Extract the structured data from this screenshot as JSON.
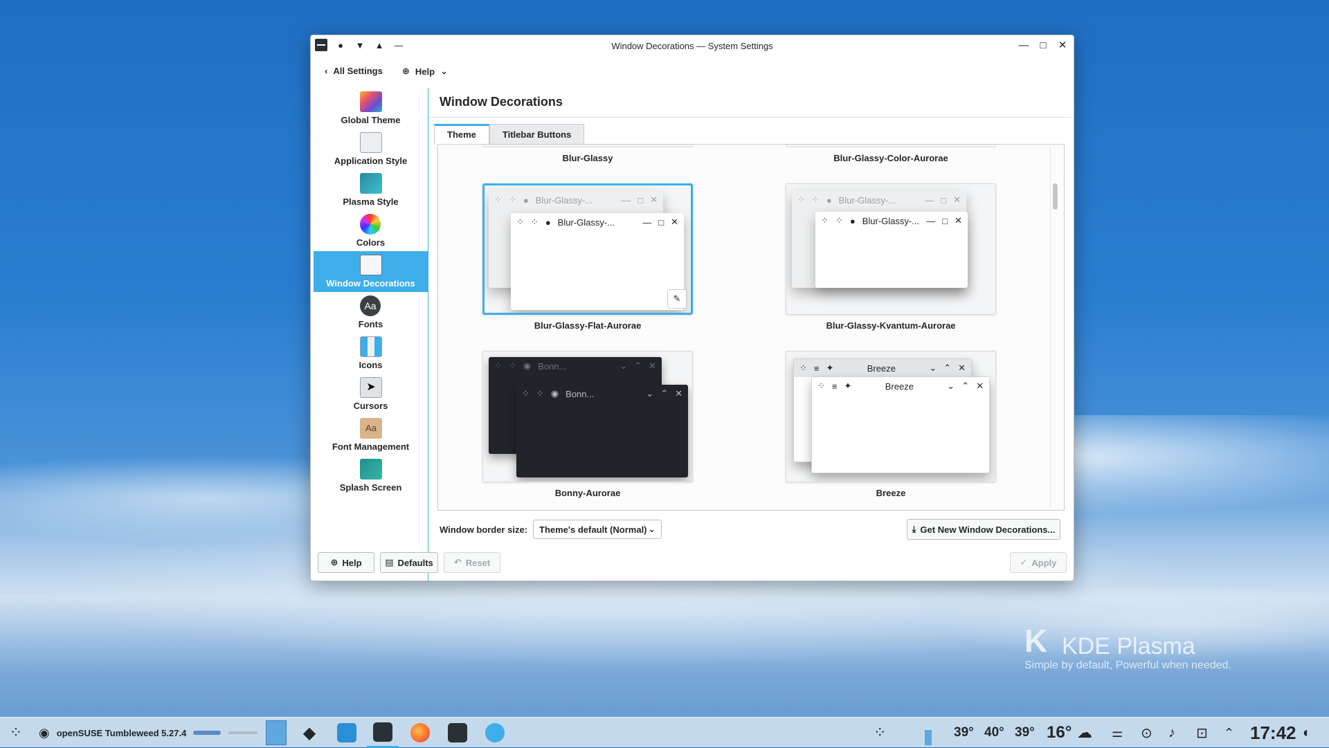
{
  "window": {
    "title": "Window Decorations — System Settings",
    "nav_all_settings": "All Settings",
    "nav_help": "Help"
  },
  "sidebar": {
    "items": [
      {
        "label": "Global Theme",
        "color": "#e8506a"
      },
      {
        "label": "Application Style",
        "color": "#eceff1"
      },
      {
        "label": "Plasma Style",
        "color": "#35a6b8"
      },
      {
        "label": "Colors",
        "color": "#ea2c8f"
      },
      {
        "label": "Window Decorations",
        "color": "#f4f6f8"
      },
      {
        "label": "Fonts",
        "color": "#444"
      },
      {
        "label": "Icons",
        "color": "#eef1f4"
      },
      {
        "label": "Cursors",
        "color": "#dfe3e6"
      },
      {
        "label": "Font Management",
        "color": "#d9b48a"
      },
      {
        "label": "Splash Screen",
        "color": "#2aa39a"
      }
    ],
    "active_index": 4
  },
  "main": {
    "page_title": "Window Decorations",
    "tabs": [
      "Theme",
      "Titlebar Buttons"
    ],
    "top_row": [
      "Blur-Glassy",
      "Blur-Glassy-Color-Aurorae"
    ],
    "themes": [
      {
        "name": "Blur-Glassy-Flat-Aurorae",
        "win_title": "Blur-Glassy-...",
        "style": "light",
        "selected": true
      },
      {
        "name": "Blur-Glassy-Kvantum-Aurorae",
        "win_title": "Blur-Glassy-...",
        "style": "light",
        "selected": false
      },
      {
        "name": "Bonny-Aurorae",
        "win_title": "Bonn...",
        "style": "dark",
        "selected": false
      },
      {
        "name": "Breeze",
        "win_title": "Breeze",
        "style": "breeze",
        "selected": false
      }
    ],
    "border_size_label": "Window border size:",
    "border_size_value": "Theme's default (Normal)",
    "get_new": "Get New Window Decorations...",
    "buttons": {
      "help": "Help",
      "defaults": "Defaults",
      "reset": "Reset",
      "apply": "Apply"
    }
  },
  "taskbar": {
    "distro": "openSUSE Tumbleweed 5.27.4",
    "weather": [
      "39°",
      "40°",
      "39°"
    ],
    "temperature": "16°",
    "clock": "17:42"
  },
  "desktop": {
    "kde_name": "KDE Plasma",
    "kde_tagline": "Simple by default, Powerful when  needed."
  },
  "colors": {
    "accent": "#3daee9"
  }
}
